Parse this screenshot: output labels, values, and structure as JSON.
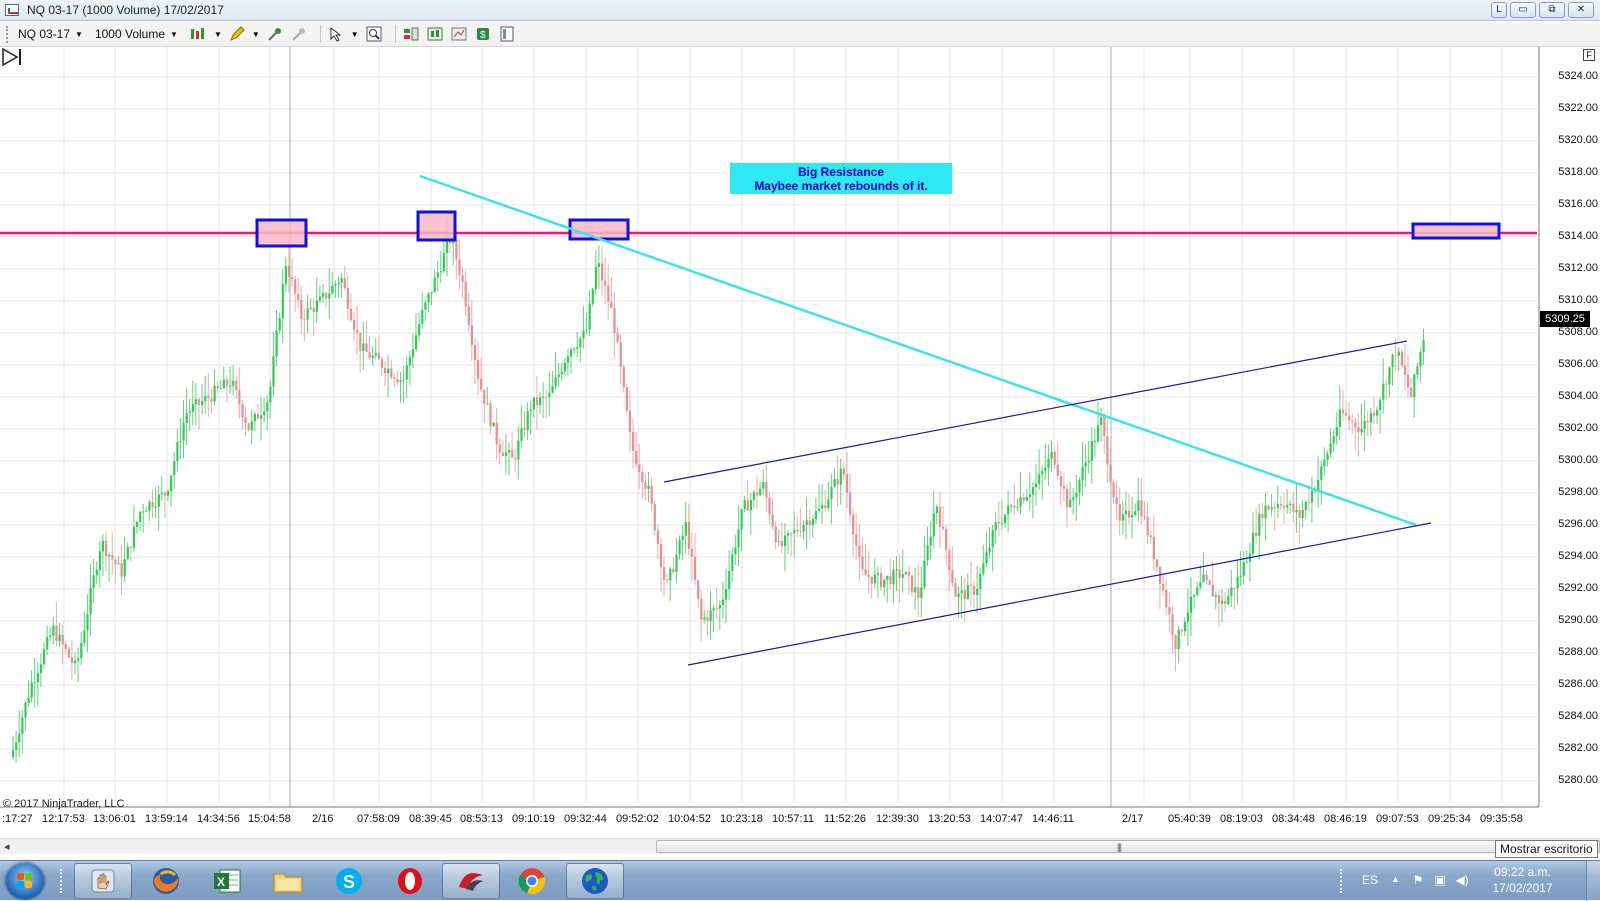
{
  "window": {
    "title": "NQ 03-17 (1000 Volume)  17/02/2017",
    "buttons": [
      "L",
      "▭",
      "⧉",
      "✕"
    ]
  },
  "toolbar": {
    "instrument": "NQ 03-17",
    "interval": "1000 Volume",
    "icons": [
      "bar-type-icon",
      "pencil-draw-icon",
      "add-indicator-icon",
      "strategy-icon",
      "cursor-icon",
      "zoom-icon",
      "chart-trader-icon",
      "data-box-icon",
      "properties-icon",
      "dollar-icon",
      "layout-icon"
    ]
  },
  "chart": {
    "price_axis_labels": [
      "5324.00",
      "5322.00",
      "5320.00",
      "5318.00",
      "5316.00",
      "5314.00",
      "5312.00",
      "5310.00",
      "5308.00",
      "5306.00",
      "5304.00",
      "5302.00",
      "5300.00",
      "5298.00",
      "5296.00",
      "5294.00",
      "5292.00",
      "5290.00",
      "5288.00",
      "5286.00",
      "5284.00",
      "5282.00",
      "5280.00"
    ],
    "current_price": "5309.25",
    "time_axis_labels": [
      ":17:27",
      "12:17:53",
      "13:06:01",
      "13:59:14",
      "14:34:56",
      "15:04:58",
      "2/16",
      "07:58:09",
      "08:39:45",
      "08:53:13",
      "09:10:19",
      "09:32:44",
      "09:52:02",
      "10:04:52",
      "10:23:18",
      "10:57:11",
      "11:52:26",
      "12:39:30",
      "13:20:53",
      "14:07:47",
      "14:46:11",
      "2/17",
      "05:40:39",
      "08:19:03",
      "08:34:48",
      "08:46:19",
      "09:07:53",
      "09:25:34",
      "09:35:58"
    ],
    "annotation_line1": "Big Resistance",
    "annotation_line2": "Maybee market rebounds of it.",
    "copyright": "© 2017 NinjaTrader, LLC",
    "panel_button": "F",
    "resistance_level": 5314.25,
    "colors": {
      "up_candle": "#2ecc52",
      "down_candle": "#e88e8e",
      "resistance_line": "#e8197c",
      "trendline": "#3de3ec",
      "channel": "#1a1aaa",
      "highlight_box_border": "#1010e0",
      "highlight_box_fill": "#f7b9c4",
      "annotation_bg": "#2ee8f2"
    }
  },
  "scrollbar": {
    "tooltip": "Mostrar escritorio"
  },
  "taskbar": {
    "apps": [
      "hand-tool-icon",
      "firefox-icon",
      "excel-icon",
      "file-explorer-icon",
      "skype-icon",
      "opera-icon",
      "ninjatrader-icon",
      "chrome-icon",
      "globe-icon"
    ],
    "language": "ES",
    "time": "09:22 a.m.",
    "date": "17/02/2017"
  }
}
